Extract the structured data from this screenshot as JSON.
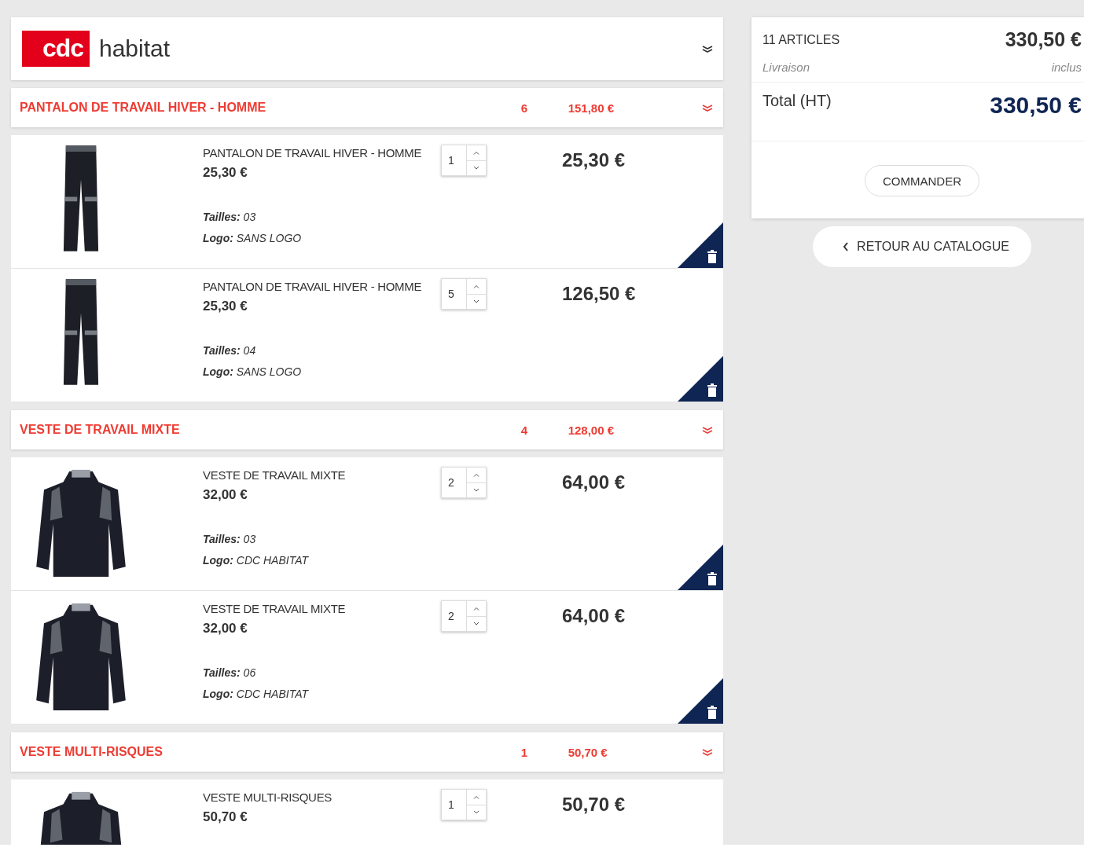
{
  "header": {
    "logo_mark": "cdc",
    "logo_text": "habitat"
  },
  "groups": [
    {
      "title": "PANTALON DE TRAVAIL HIVER - HOMME",
      "count": "6",
      "total": "151,80 €",
      "items": [
        {
          "kind": "trousers",
          "name": "PANTALON DE TRAVAIL HIVER - HOMME",
          "unit_price": "25,30 €",
          "qty": "1",
          "line_total": "25,30 €",
          "size_label": "Tailles:",
          "size": "03",
          "logo_label": "Logo:",
          "logo": "SANS LOGO"
        },
        {
          "kind": "trousers",
          "name": "PANTALON DE TRAVAIL HIVER - HOMME",
          "unit_price": "25,30 €",
          "qty": "5",
          "line_total": "126,50 €",
          "size_label": "Tailles:",
          "size": "04",
          "logo_label": "Logo:",
          "logo": "SANS LOGO"
        }
      ]
    },
    {
      "title": "VESTE DE TRAVAIL MIXTE",
      "count": "4",
      "total": "128,00 €",
      "items": [
        {
          "kind": "jacket",
          "name": "VESTE DE TRAVAIL MIXTE",
          "unit_price": "32,00 €",
          "qty": "2",
          "line_total": "64,00 €",
          "size_label": "Tailles:",
          "size": "03",
          "logo_label": "Logo:",
          "logo": "CDC HABITAT"
        },
        {
          "kind": "jacket",
          "name": "VESTE DE TRAVAIL MIXTE",
          "unit_price": "32,00 €",
          "qty": "2",
          "line_total": "64,00 €",
          "size_label": "Tailles:",
          "size": "06",
          "logo_label": "Logo:",
          "logo": "CDC HABITAT"
        }
      ]
    },
    {
      "title": "VESTE MULTI-RISQUES",
      "count": "1",
      "total": "50,70 €",
      "items": [
        {
          "kind": "jacket",
          "name": "VESTE MULTI-RISQUES",
          "unit_price": "50,70 €",
          "qty": "1",
          "line_total": "50,70 €"
        }
      ]
    }
  ],
  "summary": {
    "articles": "11 ARTICLES",
    "articles_total": "330,50 €",
    "delivery_label": "Livraison",
    "delivery_value": "inclus",
    "total_label": "Total (HT)",
    "total": "330,50 €",
    "order_button": "COMMANDER"
  },
  "back_button": "RETOUR AU CATALOGUE"
}
